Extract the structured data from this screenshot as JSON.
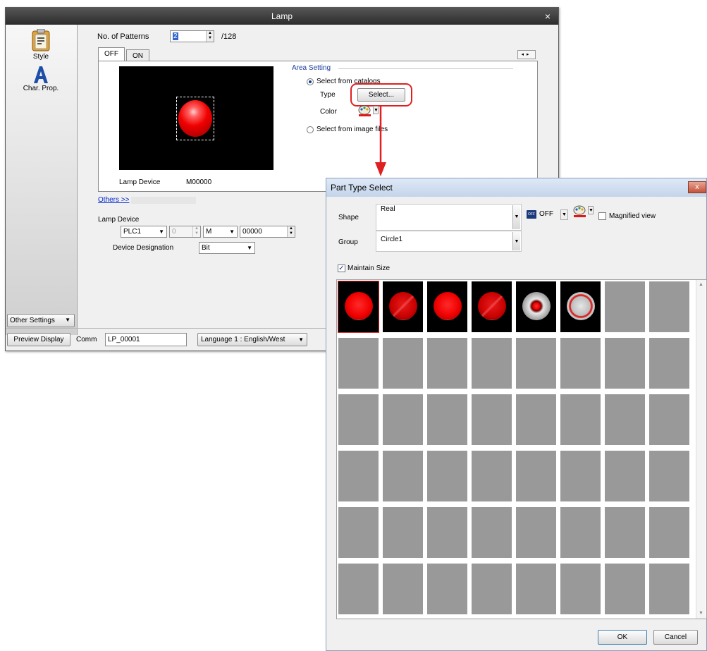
{
  "lamp_dialog": {
    "title": "Lamp",
    "close_glyph": "×",
    "sidebar": [
      {
        "label": "Style",
        "icon": "style-icon"
      },
      {
        "label": "Char. Prop.",
        "icon": "char-prop-icon"
      }
    ],
    "other_settings": "Other Settings",
    "patterns_label": "No. of Patterns",
    "patterns_value": "2",
    "patterns_max": "/128",
    "tabs": [
      "OFF",
      "ON"
    ],
    "area_setting": "Area Setting",
    "select_catalogs": "Select from catalogs",
    "type_label": "Type",
    "select_button": "Select...",
    "color_label": "Color",
    "select_image_files": "Select from image files",
    "lamp_device_caption": "Lamp Device",
    "lamp_device_value": "M00000",
    "others_link": "Others >>",
    "lamp_device_label": "Lamp Device",
    "plc": "PLC1",
    "station": "0",
    "device_type": "M",
    "address": "00000",
    "designation_label": "Device Designation",
    "designation_value": "Bit",
    "preview_button": "Preview Display",
    "comm_label": "Comm",
    "comm_value": "LP_00001",
    "language": "Language 1 : English/West"
  },
  "part_type_dialog": {
    "title": "Part Type Select",
    "close_glyph": "x",
    "shape_label": "Shape",
    "shape_value": "Real",
    "state_icon_text": "OFF",
    "state_value": "OFF",
    "magnified_label": "Magnified view",
    "group_label": "Group",
    "group_value": "Circle1",
    "maintain_size_label": "Maintain Size",
    "ok_button": "OK",
    "cancel_button": "Cancel",
    "grid_rows": 6,
    "grid_cols": 8,
    "thumbnails": [
      "red-flat",
      "red-diagonal",
      "red-flat",
      "red-diagonal",
      "red-dot-silver",
      "red-ring-silver"
    ]
  },
  "colors": {
    "annotation": "#e02020",
    "lamp_red": "#f00000",
    "empty_cell": "#999999"
  }
}
